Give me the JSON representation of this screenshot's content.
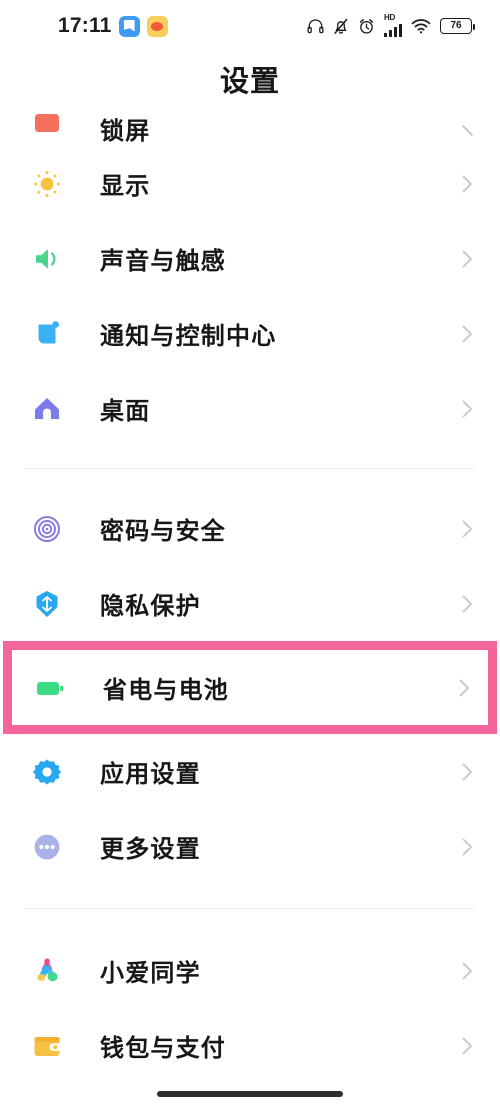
{
  "status_bar": {
    "time": "17:11",
    "left_icons": [
      {
        "name": "messaging-app-icon",
        "style": "blue"
      },
      {
        "name": "eye-app-icon",
        "style": "gold"
      }
    ],
    "right_icons": [
      "headphones-icon",
      "bell-muted-icon",
      "alarm-clock-icon",
      "hd-signal-icon",
      "wifi-icon",
      "battery-icon"
    ],
    "hd_label": "HD",
    "battery_level": "76"
  },
  "header": {
    "title": "设置"
  },
  "colors": {
    "highlight": "#f4659c",
    "lockscreen_icon": "#f4705c",
    "display_icon": "#f5c43c",
    "sound_icon": "#4ad48d",
    "notification_icon": "#3bb0f5",
    "home_icon": "#7b7bea",
    "security_icon": "#8a7be0",
    "privacy_icon": "#2aa7ef",
    "battery_icon": "#3cdc84",
    "apps_icon": "#2aa7ef",
    "more_icon": "#a9b3e8",
    "xiaoai_icon": "#f0478f",
    "wallet_icon": "#f5c043"
  },
  "sections": [
    {
      "name": "section-display",
      "items": [
        {
          "label": "锁屏",
          "icon": "lockscreen-icon",
          "clipped": true,
          "chevron": "chevron-right-icon"
        },
        {
          "label": "显示",
          "icon": "display-icon",
          "chevron": "chevron-right-icon"
        },
        {
          "label": "声音与触感",
          "icon": "sound-icon",
          "chevron": "chevron-right-icon"
        },
        {
          "label": "通知与控制中心",
          "icon": "notification-icon",
          "chevron": "chevron-right-icon"
        },
        {
          "label": "桌面",
          "icon": "home-screen-icon",
          "chevron": "chevron-right-icon"
        }
      ]
    },
    {
      "name": "section-security",
      "items": [
        {
          "label": "密码与安全",
          "icon": "fingerprint-icon",
          "chevron": "chevron-right-icon"
        },
        {
          "label": "隐私保护",
          "icon": "privacy-shield-icon",
          "chevron": "chevron-right-icon"
        },
        {
          "label": "省电与电池",
          "icon": "battery-icon",
          "chevron": "chevron-right-icon",
          "highlighted": true
        },
        {
          "label": "应用设置",
          "icon": "gear-icon",
          "chevron": "chevron-right-icon"
        },
        {
          "label": "更多设置",
          "icon": "more-dots-icon",
          "chevron": "chevron-right-icon"
        }
      ]
    },
    {
      "name": "section-services",
      "items": [
        {
          "label": "小爱同学",
          "icon": "xiaoai-icon",
          "chevron": "chevron-right-icon"
        },
        {
          "label": "钱包与支付",
          "icon": "wallet-icon",
          "chevron": "chevron-right-icon"
        }
      ]
    }
  ],
  "nav": {
    "home_indicator": "home-indicator"
  }
}
